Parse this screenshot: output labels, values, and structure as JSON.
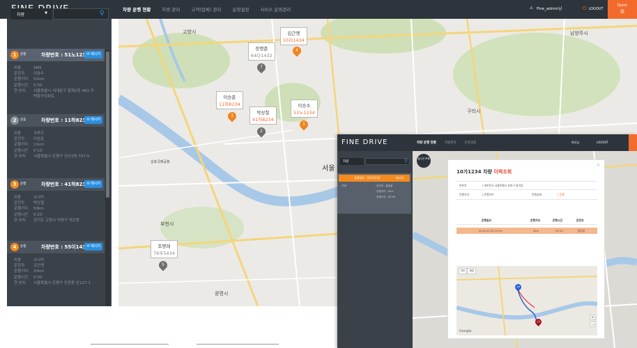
{
  "header": {
    "logo": "FINE DRIVE",
    "nav": [
      "차량 운행 현황",
      "차량 관리",
      "고객(업체) 관리",
      "운영설정",
      "서비스 운영관리"
    ],
    "active_nav": 0,
    "user": "Fine_admin님",
    "logout": "LOGOUT",
    "quick": "Quick"
  },
  "search": {
    "select_label": "차량",
    "placeholder": ""
  },
  "vehicles": [
    {
      "num": "1",
      "status": "운행",
      "title": "차량번호 : 51노1234",
      "msg": "메시지",
      "color": "orange",
      "rows": [
        [
          "차종",
          "SM5"
        ],
        [
          "운전자",
          "이승수"
        ],
        [
          "운행거리",
          "51km"
        ],
        [
          "운행시간",
          "0'30'"
        ],
        [
          "현 위치",
          "서울특별시 서대문구 홍제2동 463 주택형구아파트"
        ]
      ]
    },
    {
      "num": "2",
      "status": "운휴",
      "title": "차량번호 : 11하8234",
      "msg": "메시지",
      "color": "grey",
      "rows": [
        [
          "차종",
          "크루즈"
        ],
        [
          "운전자",
          "이승준"
        ],
        [
          "운행거리",
          "11km"
        ],
        [
          "운행시간",
          "0'10'"
        ],
        [
          "현 위치",
          "서울특별시 은평구 신사2동 337-5"
        ]
      ]
    },
    {
      "num": "3",
      "status": "운행",
      "title": "차량번호 : 41허8234",
      "msg": "메시지",
      "color": "orange",
      "rows": [
        [
          "차종",
          "소나타"
        ],
        [
          "운전자",
          "박상철"
        ],
        [
          "운행거리",
          "50km"
        ],
        [
          "운행시간",
          "0'20'"
        ],
        [
          "현 위치",
          "경기도 고양시 덕양구 덕은동"
        ]
      ]
    },
    {
      "num": "4",
      "status": "운행",
      "title": "차량번호 : 55이1434",
      "msg": "메시지",
      "color": "orange",
      "rows": [
        [
          "차종",
          "소나타"
        ],
        [
          "운전자",
          "김근엥"
        ],
        [
          "운행거리",
          "33km"
        ],
        [
          "운행시간",
          "0'30'"
        ],
        [
          "현 위치",
          "서울특별시 은평구 진관동 산127-1"
        ]
      ]
    }
  ],
  "map": {
    "places": [
      "고양시",
      "서울",
      "부천시",
      "남양주시",
      "구리시",
      "광명시",
      "김포국제공항"
    ],
    "markers": [
      {
        "name": "김근엥",
        "plate": "55이1434",
        "num": "4",
        "color": "orange"
      },
      {
        "name": "장병준",
        "plate": "64다1432",
        "num": "7",
        "color": "grey"
      },
      {
        "name": "이승준",
        "plate": "11하8234",
        "num": "3",
        "color": "orange"
      },
      {
        "name": "박상철",
        "plate": "41허8234",
        "num": "2",
        "color": "grey"
      },
      {
        "name": "이승수",
        "plate": "51노1234",
        "num": "1",
        "color": "orange"
      },
      {
        "name": "조명래",
        "plate": "76우5434",
        "num": "5",
        "color": "grey"
      }
    ]
  },
  "inset": {
    "logo": "FINE DRIVE",
    "nav": [
      "차량 운행 현황",
      "차량관리",
      "운영설정"
    ],
    "user": "파인님",
    "logout": "LOGOUT",
    "side_select": "차량",
    "side_card_title": "차량번호 : 10가1234",
    "side_card_msg": "메시지",
    "side_rows": [
      "· 차량",
      "· 운전자 : 홍길동",
      "· 운행거리 : 0km",
      "· 운행시간 : 00:00"
    ],
    "circle_label": "실시간 조회",
    "modal": {
      "title_plate": "10가1234 차량",
      "title_red": "이력조회",
      "close": "×",
      "r1_label": "현위치",
      "r1_value": "1 대한민국 서울특별시 송파구 방이동",
      "r2_label": "운행거리",
      "r2_value": "1 운행거리",
      "r2_label2": "운행상태",
      "r2_value2": "1 운행",
      "th": [
        "운행일자",
        "운행거리",
        "운행시간",
        "운전자"
      ],
      "row": [
        "2018.03.26 20:00",
        "0km",
        "00'00'",
        "홍길동"
      ],
      "map_btns": [
        "지도",
        "위성"
      ],
      "pin_start": "출발",
      "pin_end": "도착",
      "google": "Google"
    }
  },
  "colors": {
    "header": "#2d343b",
    "panel": "#3a4148",
    "accent": "#f26b2c",
    "blue": "#2a8fe0"
  }
}
